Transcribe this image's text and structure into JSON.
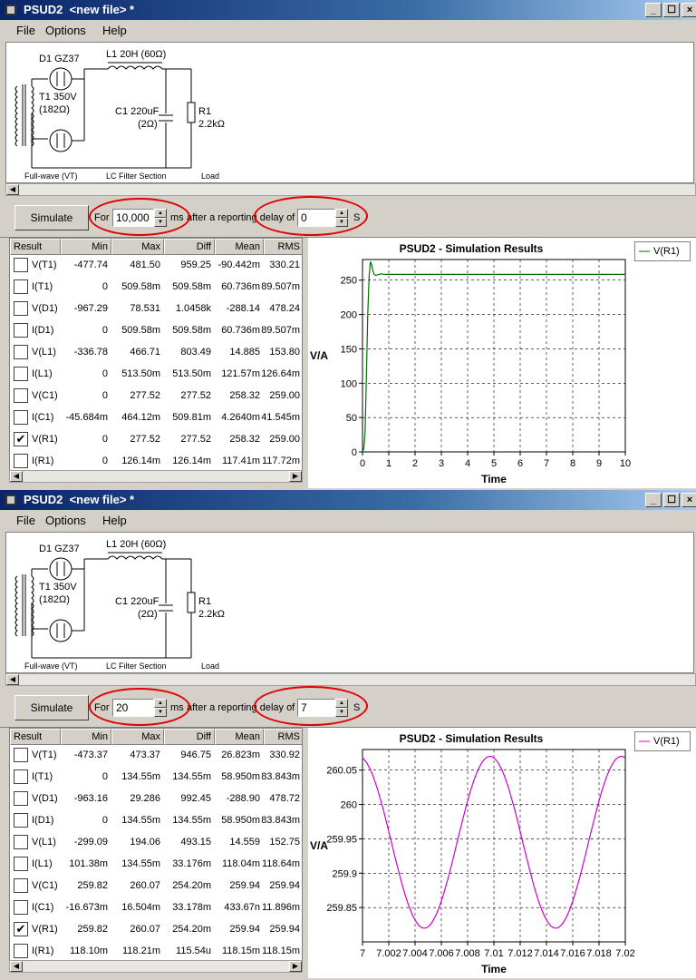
{
  "windows": [
    {
      "title": "PSUD2  <new file> *",
      "menu": [
        "File",
        "Options",
        "Help"
      ],
      "window_buttons": [
        "_",
        "☐",
        "×"
      ],
      "schematic": {
        "d1": "D1 GZ37",
        "l1": "L1 20H (60Ω)",
        "t1a": "T1 350V",
        "t1b": "(182Ω)",
        "c1a": "C1 220uF",
        "c1b": "(2Ω)",
        "r1a": "R1",
        "r1b": "2.2kΩ",
        "sec1": "Full-wave (VT)",
        "sec2": "LC Filter Section",
        "sec3": "Load"
      },
      "controls": {
        "simulate": "Simulate",
        "for_label": "For",
        "duration": "10,000",
        "ms_label": "ms",
        "after_label": "after a reporting delay of",
        "delay": "0",
        "s_label": "S"
      },
      "table": {
        "headers": [
          "Result",
          "Min",
          "Max",
          "Diff",
          "Mean",
          "RMS"
        ],
        "rows": [
          {
            "checked": false,
            "name": "V(T1)",
            "min": "-477.74",
            "max": "481.50",
            "diff": "959.25",
            "mean": "-90.442m",
            "rms": "330.21"
          },
          {
            "checked": false,
            "name": "I(T1)",
            "min": "0",
            "max": "509.58m",
            "diff": "509.58m",
            "mean": "60.736m",
            "rms": "89.507m"
          },
          {
            "checked": false,
            "name": "V(D1)",
            "min": "-967.29",
            "max": "78.531",
            "diff": "1.0458k",
            "mean": "-288.14",
            "rms": "478.24"
          },
          {
            "checked": false,
            "name": "I(D1)",
            "min": "0",
            "max": "509.58m",
            "diff": "509.58m",
            "mean": "60.736m",
            "rms": "89.507m"
          },
          {
            "checked": false,
            "name": "V(L1)",
            "min": "-336.78",
            "max": "466.71",
            "diff": "803.49",
            "mean": "14.885",
            "rms": "153.80"
          },
          {
            "checked": false,
            "name": "I(L1)",
            "min": "0",
            "max": "513.50m",
            "diff": "513.50m",
            "mean": "121.57m",
            "rms": "126.64m"
          },
          {
            "checked": false,
            "name": "V(C1)",
            "min": "0",
            "max": "277.52",
            "diff": "277.52",
            "mean": "258.32",
            "rms": "259.00"
          },
          {
            "checked": false,
            "name": "I(C1)",
            "min": "-45.684m",
            "max": "464.12m",
            "diff": "509.81m",
            "mean": "4.2640m",
            "rms": "41.545m"
          },
          {
            "checked": true,
            "name": "V(R1)",
            "min": "0",
            "max": "277.52",
            "diff": "277.52",
            "mean": "258.32",
            "rms": "259.00"
          },
          {
            "checked": false,
            "name": "I(R1)",
            "min": "0",
            "max": "126.14m",
            "diff": "126.14m",
            "mean": "117.41m",
            "rms": "117.72m"
          }
        ]
      },
      "legend": "V(R1)"
    },
    {
      "title": "PSUD2  <new file> *",
      "menu": [
        "File",
        "Options",
        "Help"
      ],
      "window_buttons": [
        "_",
        "☐",
        "×"
      ],
      "schematic": {
        "d1": "D1 GZ37",
        "l1": "L1 20H (60Ω)",
        "t1a": "T1 350V",
        "t1b": "(182Ω)",
        "c1a": "C1 220uF",
        "c1b": "(2Ω)",
        "r1a": "R1",
        "r1b": "2.2kΩ",
        "sec1": "Full-wave (VT)",
        "sec2": "LC Filter Section",
        "sec3": "Load"
      },
      "controls": {
        "simulate": "Simulate",
        "for_label": "For",
        "duration": "20",
        "ms_label": "ms",
        "after_label": "after a reporting delay of",
        "delay": "7",
        "s_label": "S"
      },
      "table": {
        "headers": [
          "Result",
          "Min",
          "Max",
          "Diff",
          "Mean",
          "RMS"
        ],
        "rows": [
          {
            "checked": false,
            "name": "V(T1)",
            "min": "-473.37",
            "max": "473.37",
            "diff": "946.75",
            "mean": "26.823m",
            "rms": "330.92"
          },
          {
            "checked": false,
            "name": "I(T1)",
            "min": "0",
            "max": "134.55m",
            "diff": "134.55m",
            "mean": "58.950m",
            "rms": "83.843m"
          },
          {
            "checked": false,
            "name": "V(D1)",
            "min": "-963.16",
            "max": "29.286",
            "diff": "992.45",
            "mean": "-288.90",
            "rms": "478.72"
          },
          {
            "checked": false,
            "name": "I(D1)",
            "min": "0",
            "max": "134.55m",
            "diff": "134.55m",
            "mean": "58.950m",
            "rms": "83.843m"
          },
          {
            "checked": false,
            "name": "V(L1)",
            "min": "-299.09",
            "max": "194.06",
            "diff": "493.15",
            "mean": "14.559",
            "rms": "152.75"
          },
          {
            "checked": false,
            "name": "I(L1)",
            "min": "101.38m",
            "max": "134.55m",
            "diff": "33.176m",
            "mean": "118.04m",
            "rms": "118.64m"
          },
          {
            "checked": false,
            "name": "V(C1)",
            "min": "259.82",
            "max": "260.07",
            "diff": "254.20m",
            "mean": "259.94",
            "rms": "259.94"
          },
          {
            "checked": false,
            "name": "I(C1)",
            "min": "-16.673m",
            "max": "16.504m",
            "diff": "33.178m",
            "mean": "433.67n",
            "rms": "11.896m"
          },
          {
            "checked": true,
            "name": "V(R1)",
            "min": "259.82",
            "max": "260.07",
            "diff": "254.20m",
            "mean": "259.94",
            "rms": "259.94"
          },
          {
            "checked": false,
            "name": "I(R1)",
            "min": "118.10m",
            "max": "118.21m",
            "diff": "115.54u",
            "mean": "118.15m",
            "rms": "118.15m"
          }
        ]
      },
      "legend": "V(R1)"
    }
  ],
  "chart_data": [
    {
      "type": "line",
      "title": "PSUD2 - Simulation Results",
      "xlabel": "Time",
      "ylabel": "V/A",
      "xlim": [
        0,
        10
      ],
      "ylim": [
        0,
        280
      ],
      "xticks": [
        "0",
        "1",
        "2",
        "3",
        "4",
        "5",
        "6",
        "7",
        "8",
        "9",
        "10"
      ],
      "yticks": [
        "0",
        "50",
        "100",
        "150",
        "200",
        "250"
      ],
      "grid": true,
      "legend_position": "right",
      "series": [
        {
          "name": "V(R1)",
          "color": "#007000",
          "x": [
            0,
            0.05,
            0.1,
            0.15,
            0.2,
            0.25,
            0.3,
            0.35,
            0.4,
            0.45,
            0.5,
            0.6,
            0.7,
            0.8,
            1.0,
            1.5,
            2,
            3,
            4,
            5,
            6,
            7,
            8,
            9,
            10
          ],
          "y": [
            0,
            5,
            30,
            110,
            200,
            255,
            277,
            272,
            263,
            258,
            257,
            258,
            259,
            258.5,
            258.3,
            258.3,
            258.3,
            258.3,
            258.3,
            258.3,
            258.3,
            258.3,
            258.3,
            258.3,
            258.3
          ]
        }
      ]
    },
    {
      "type": "line",
      "title": "PSUD2 - Simulation Results",
      "xlabel": "Time",
      "ylabel": "V/A",
      "xlim": [
        7,
        7.02
      ],
      "ylim": [
        259.8,
        260.08
      ],
      "xticks": [
        "7",
        "7.002",
        "7.004",
        "7.006",
        "7.008",
        "7.01",
        "7.012",
        "7.014",
        "7.016",
        "7.018",
        "7.02"
      ],
      "yticks": [
        "259.85",
        "259.9",
        "259.95",
        "260",
        "260.05"
      ],
      "grid": true,
      "legend_position": "right",
      "series": [
        {
          "name": "V(R1)",
          "color": "#d000d0",
          "sine": {
            "mean": 259.945,
            "amplitude": 0.125,
            "period": 0.01,
            "peak_at": 7.0097
          }
        }
      ]
    }
  ]
}
